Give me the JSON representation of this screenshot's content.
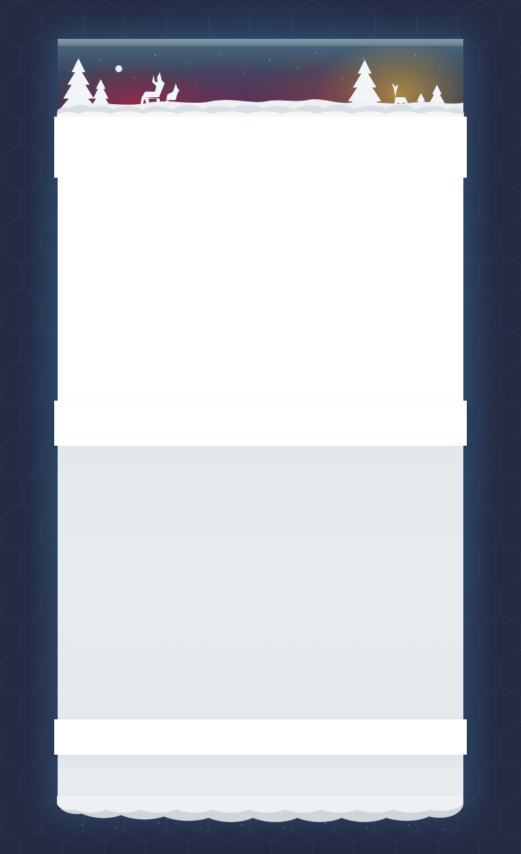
{
  "page": {
    "background_color": "#252a42",
    "glow_color": "#2e6ea0",
    "panel_color": "#ffffff",
    "lower_panel_color": "#e6eaed"
  },
  "header": {
    "scene_icons": [
      "tree-icon",
      "deer-icon",
      "moon-icon",
      "snow-icon"
    ],
    "aurora_colors": [
      "#aa2846",
      "#d2a03c"
    ]
  },
  "sections": [
    {
      "name": "top-band",
      "text": ""
    },
    {
      "name": "content-area",
      "text": ""
    },
    {
      "name": "middle-band",
      "text": ""
    },
    {
      "name": "lower-content-area",
      "text": ""
    },
    {
      "name": "bottom-band",
      "text": ""
    }
  ]
}
